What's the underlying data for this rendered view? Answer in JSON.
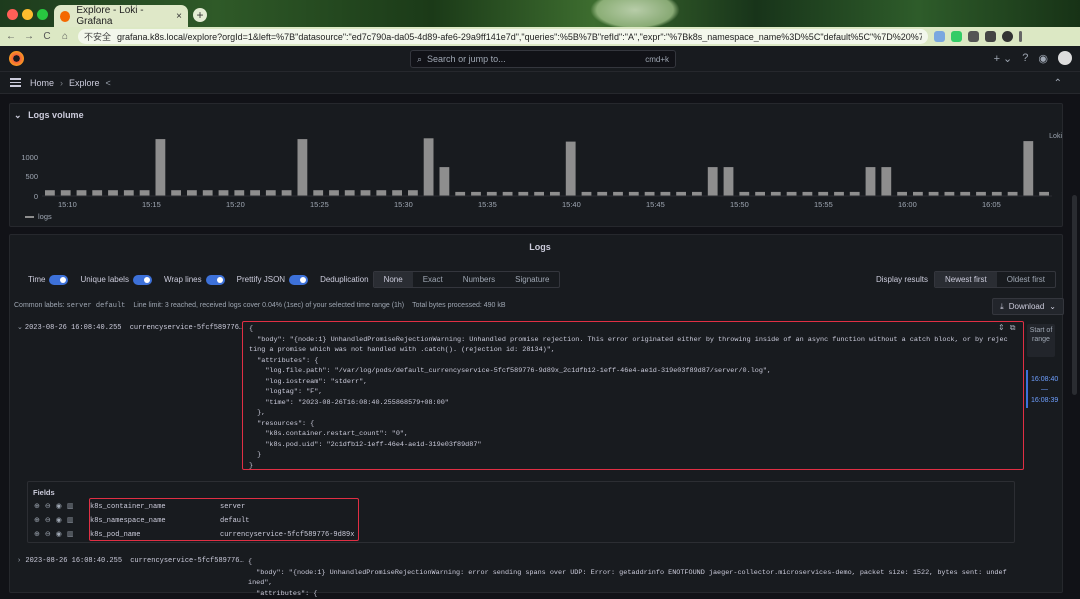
{
  "browser": {
    "tab_title": "Explore - Loki - Grafana",
    "tab_close": "×",
    "new_tab": "+",
    "insecure_label": "不安全",
    "url": "grafana.k8s.local/explore?orgId=1&left=%7B\"datasource\":\"ed7c790a-da05-4d89-afe6-29a9ff141e7d\",\"queries\":%5B%7B\"refId\":\"A\",\"expr\":\"%7Bk8s_namespace_name%3D%5C\"default%5C\"%7D%20%7C...",
    "back": "←",
    "forward": "→",
    "reload": "C",
    "home": "⌂"
  },
  "topbar": {
    "search_placeholder": "Search or jump to...",
    "search_shortcut": "cmd+k",
    "plus": "+ ⌄",
    "help": "?",
    "news": "◉"
  },
  "breadcrumbs": {
    "home": "Home",
    "sep": "›",
    "current": "Explore",
    "share": "<",
    "expand": "⌃"
  },
  "logs_volume": {
    "title": "Logs volume",
    "collapse": "⌄",
    "datasource": "Loki",
    "legend": "logs"
  },
  "chart_data": {
    "type": "bar",
    "title": "Logs volume",
    "xlabel": "",
    "ylabel": "",
    "ylim": [
      0,
      1600
    ],
    "yticks": [
      "1000",
      "500",
      "0"
    ],
    "xticks": [
      "15:10",
      "15:15",
      "15:20",
      "15:25",
      "15:30",
      "15:35",
      "15:40",
      "15:45",
      "15:50",
      "15:55",
      "16:00",
      "16:05"
    ],
    "series": [
      {
        "name": "logs",
        "values": [
          140,
          140,
          140,
          140,
          140,
          140,
          140,
          1380,
          140,
          140,
          140,
          140,
          140,
          140,
          140,
          140,
          1380,
          140,
          140,
          140,
          140,
          140,
          140,
          140,
          1400,
          700,
          100,
          100,
          100,
          100,
          100,
          100,
          100,
          1320,
          100,
          100,
          100,
          100,
          100,
          100,
          100,
          100,
          700,
          700,
          100,
          100,
          100,
          100,
          100,
          100,
          100,
          100,
          700,
          700,
          100,
          100,
          100,
          100,
          100,
          100,
          100,
          100,
          1330,
          100
        ]
      }
    ],
    "color": "#8e8e8e"
  },
  "logs": {
    "title": "Logs",
    "options": {
      "time": "Time",
      "unique_labels": "Unique labels",
      "wrap_lines": "Wrap lines",
      "prettify_json": "Prettify JSON",
      "dedup_label": "Deduplication",
      "dedup_options": [
        "None",
        "Exact",
        "Numbers",
        "Signature"
      ],
      "display_results": "Display results",
      "order_options": [
        "Newest first",
        "Oldest first"
      ]
    },
    "common_labels_label": "Common labels:",
    "common_labels_value": "server default",
    "line_limit": "Line limit: 3 reached, received logs cover 0.04% (1sec) of your selected time range (1h)",
    "bytes_processed": "Total bytes processed: 490 kB",
    "download": "Download",
    "entry1": {
      "chevron": "⌄",
      "timestamp": "2023-08-26 16:08:40.255",
      "labels": "currencyservice-5fcf589776…",
      "json": "{\n  \"body\": \"{node:1} UnhandledPromiseRejectionWarning: Unhandled promise rejection. This error originated either by throwing inside of an async function without a catch block, or by rejec\nting a promise which was not handled with .catch(). (rejection id: 28134)\",\n  \"attributes\": {\n    \"log.file.path\": \"/var/log/pods/default_currencyservice-5fcf589776-9d89x_2c1dfb12-1eff-46e4-ae1d-319e03f89d87/server/0.log\",\n    \"log.iostream\": \"stderr\",\n    \"logtag\": \"F\",\n    \"time\": \"2023-08-26T16:08:40.255868579+08:00\"\n  },\n  \"resources\": {\n    \"k8s.container.restart_count\": \"0\",\n    \"k8s.pod.uid\": \"2c1dfb12-1eff-46e4-ae1d-319e03f89d87\"\n  }\n}"
    },
    "fields": {
      "title": "Fields",
      "rows": [
        {
          "key": "k8s_container_name",
          "value": "server"
        },
        {
          "key": "k8s_namespace_name",
          "value": "default"
        },
        {
          "key": "k8s_pod_name",
          "value": "currencyservice-5fcf589776-9d89x"
        }
      ]
    },
    "entry2": {
      "chevron": "›",
      "timestamp": "2023-08-26 16:08:40.255",
      "labels": "currencyservice-5fcf589776…",
      "json": "{\n  \"body\": \"{node:1} UnhandledPromiseRejectionWarning: error sending spans over UDP: Error: getaddrinfo ENOTFOUND jaeger-collector.microservices-demo, packet size: 1522, bytes sent: undef\nined\",\n  \"attributes\": {"
    }
  },
  "range_nav": {
    "start_of_range": "Start of range",
    "time_top": "16:08:40",
    "dash": "—",
    "time_bottom": "16:08:39"
  },
  "colors": {
    "accent": "#3d71d9",
    "highlight": "#e02f44",
    "bar": "#8e8e8e"
  }
}
